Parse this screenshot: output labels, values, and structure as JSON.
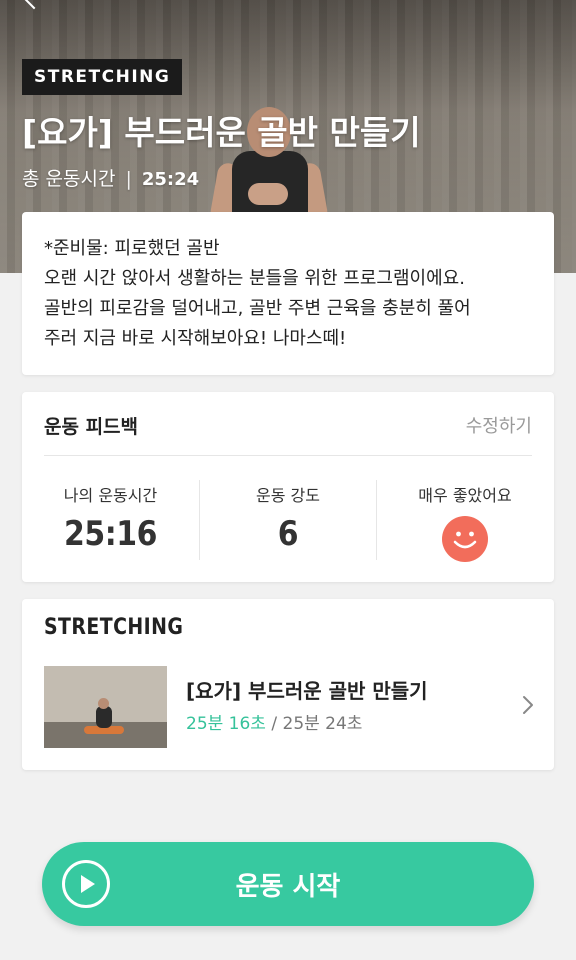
{
  "hero": {
    "badge": "STRETCHING",
    "title": "[요가] 부드러운 골반 만들기",
    "meta_label": "총 운동시간",
    "meta_separator": "|",
    "meta_time": "25:24"
  },
  "description": {
    "lines": [
      "*준비물: 피로했던 골반",
      "오랜 시간 앉아서 생활하는 분들을 위한 프로그램이에요.",
      "골반의 피로감을 덜어내고, 골반 주변 근육을 충분히 풀어",
      "주러 지금 바로 시작해보아요! 나마스떼!"
    ]
  },
  "feedback": {
    "title": "운동 피드백",
    "edit_label": "수정하기",
    "my_time_label": "나의 운동시간",
    "my_time_value": "25:16",
    "intensity_label": "운동 강도",
    "intensity_value": "6",
    "rating_label": "매우 좋았어요",
    "rating_icon": "smiley-face-icon",
    "rating_color": "#f26d5b"
  },
  "program": {
    "category": "STRETCHING",
    "title": "[요가] 부드러운 골반 만들기",
    "done_time": "25분 16초",
    "separator": " / ",
    "total_time": "25분 24초"
  },
  "start_button": {
    "label": "운동 시작",
    "icon": "play-icon",
    "color": "#37c9a0"
  }
}
